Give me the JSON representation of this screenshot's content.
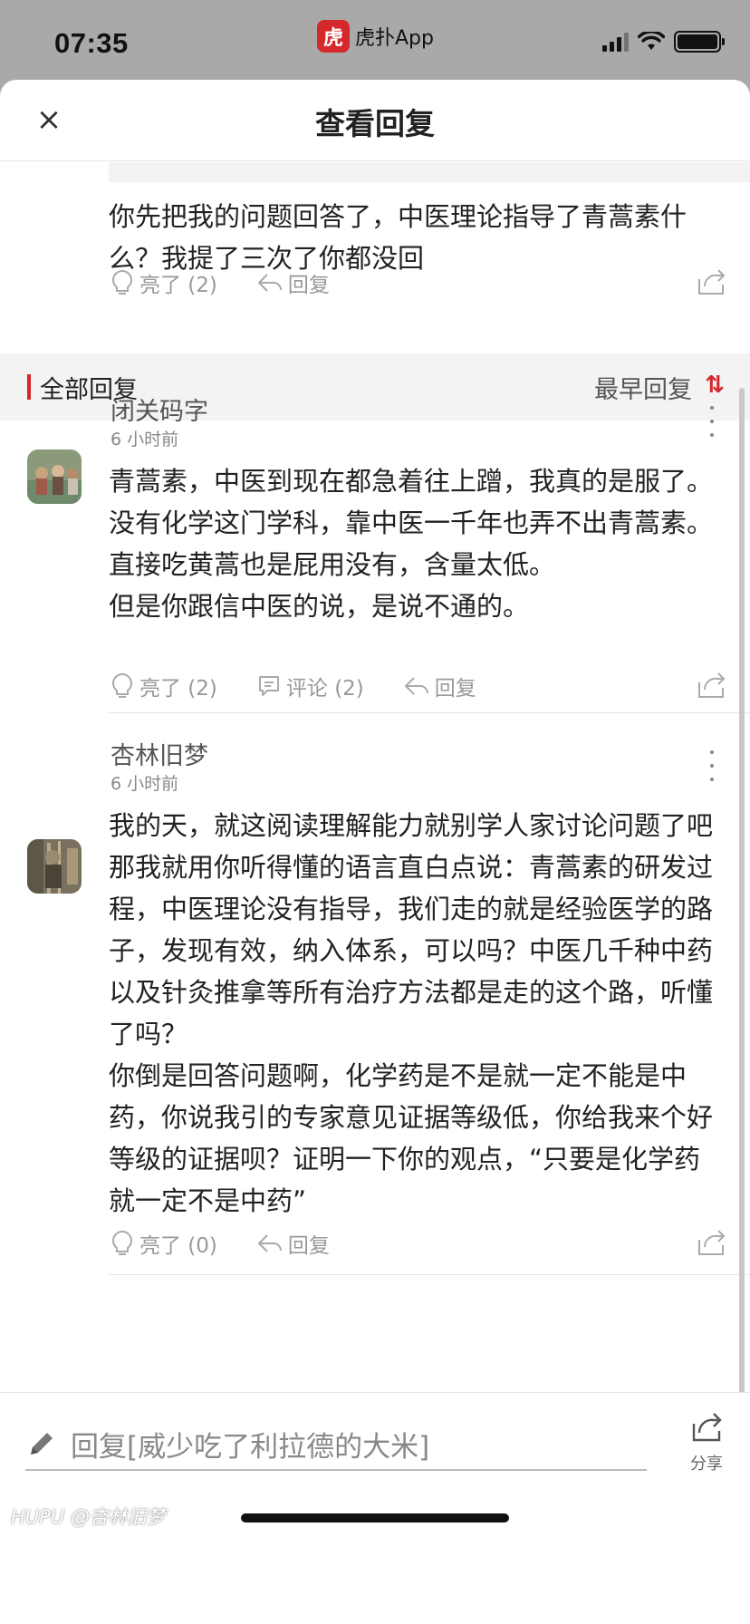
{
  "status_bar": {
    "time": "07:35",
    "app_logo_char": "虎",
    "app_name": "虎扑App",
    "icons": [
      "signal-icon",
      "wifi-icon",
      "battery-icon"
    ]
  },
  "header": {
    "close_label": "×",
    "title": "查看回复"
  },
  "quoted": {
    "text": "你先把我的问题回答了，中医理论指导了青蒿素什么？我提了三次了你都没回",
    "like_label": "亮了 (2)",
    "reply_label": "回复"
  },
  "section": {
    "title": "全部回复",
    "sort_label": "最早回复",
    "sort_icon": "⇅"
  },
  "replies": [
    {
      "username": "闭关码字",
      "time": "6 小时前",
      "paragraphs": [
        "青蒿素，中医到现在都急着往上蹭，我真的是服了。",
        "没有化学这门学科，靠中医一千年也弄不出青蒿素。直接吃黄蒿也是屁用没有，含量太低。",
        "但是你跟信中医的说，是说不通的。"
      ],
      "like_label": "亮了 (2)",
      "comment_label": "评论 (2)",
      "reply_label": "回复"
    },
    {
      "username": "杏林旧梦",
      "time": "6 小时前",
      "paragraphs": [
        "我的天，就这阅读理解能力就别学人家讨论问题了吧",
        "那我就用你听得懂的语言直白点说：青蒿素的研发过程，中医理论没有指导，我们走的就是经验医学的路子，发现有效，纳入体系，可以吗？中医几千种中药以及针灸推拿等所有治疗方法都是走的这个路，听懂了吗？",
        "你倒是回答问题啊，化学药是不是就一定不能是中药，你说我引的专家意见证据等级低，你给我来个好等级的证据呗？证明一下你的观点，“只要是化学药就一定不是中药”"
      ],
      "like_label": "亮了 (0)",
      "reply_label": "回复"
    }
  ],
  "bottom": {
    "reply_placeholder": "回复[威少吃了利拉德的大米]",
    "share_label": "分享"
  },
  "watermark": "HUPU @杏林旧梦",
  "colors": {
    "accent": "#d4282b",
    "text": "#222222",
    "muted": "#999999",
    "status_bg": "#a9a9a9"
  }
}
